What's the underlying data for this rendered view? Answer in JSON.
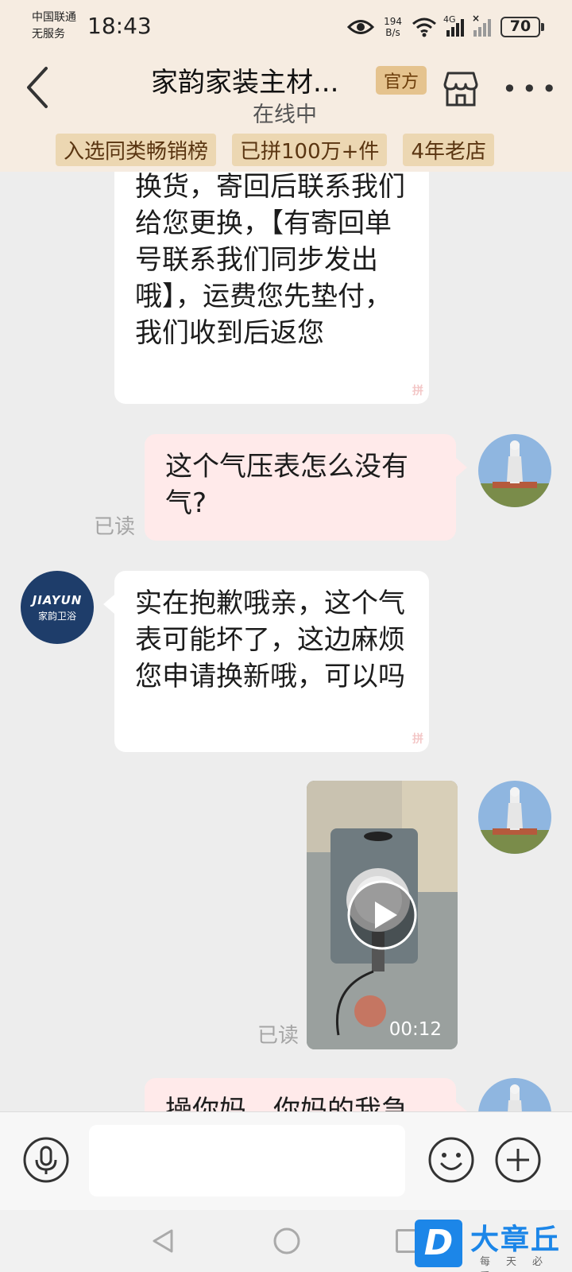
{
  "status_bar": {
    "carrier": "中国联通",
    "service": "无服务",
    "time": "18:43",
    "speed_value": "194",
    "speed_unit": "B/s",
    "network": "4G",
    "battery": "70"
  },
  "header": {
    "title": "家韵家装主材...",
    "official_badge": "官方",
    "status": "在线中",
    "tags": [
      "入选同类畅销榜",
      "已拼100万+件",
      "4年老店"
    ]
  },
  "messages": [
    {
      "side": "left",
      "text": "换货，寄回后联系我们给您更换，【有寄回单号联系我们同步发出哦】，运费您先垫付，我们收到后返您"
    },
    {
      "side": "right",
      "text": "这个气压表怎么没有气?",
      "read": "已读"
    },
    {
      "side": "left",
      "text": "实在抱歉哦亲，这个气表可能坏了，这边麻烦您申请换新哦，可以吗"
    },
    {
      "side": "right",
      "type": "video",
      "duration": "00:12",
      "read": "已读"
    },
    {
      "side": "right",
      "text": "操你妈，你妈的我急"
    }
  ],
  "shop_avatar": {
    "line1": "JIAYUN",
    "line2": "家韵卫浴"
  },
  "stamp_char": "拼",
  "input": {
    "placeholder": ""
  },
  "watermark": {
    "title": "大章丘",
    "subtitle": "每天必看",
    "logo": "D"
  },
  "icons": [
    "back-icon",
    "store-icon",
    "more-icon",
    "eye-icon",
    "wifi-icon",
    "signal-icon",
    "microphone-icon",
    "emoji-icon",
    "plus-icon",
    "play-icon"
  ]
}
